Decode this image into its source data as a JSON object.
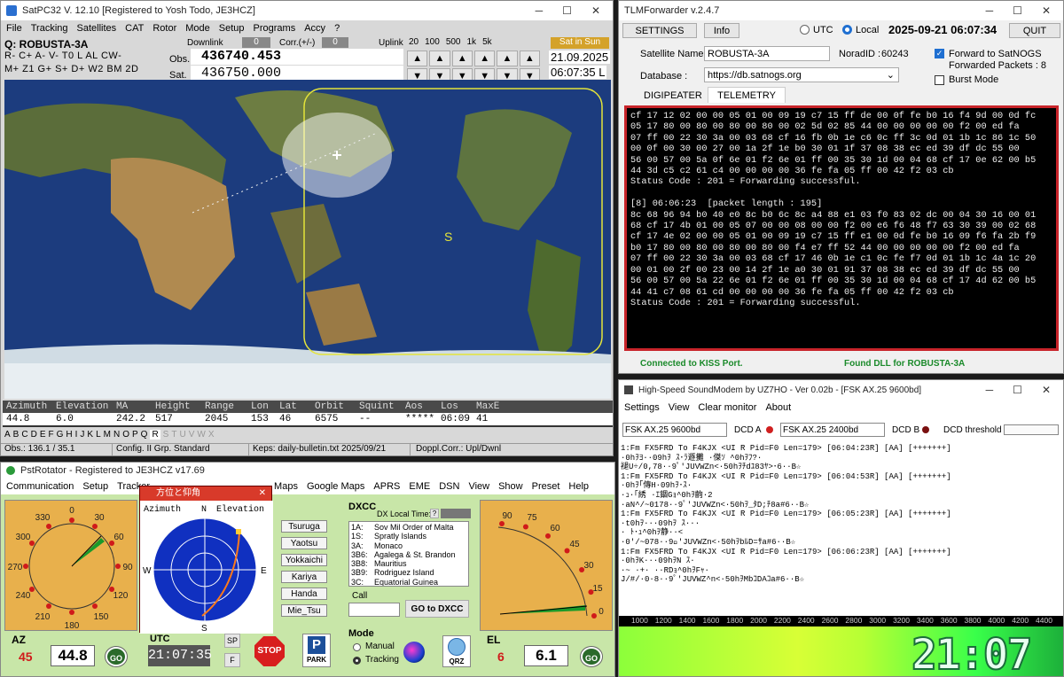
{
  "satpc": {
    "title": "SatPC32  V. 12.10    [Registered to Yosh Todo, JE3HCZ]",
    "menu": [
      "File",
      "Tracking",
      "Satellites",
      "CAT",
      "Rotor",
      "Mode",
      "Setup",
      "Programs",
      "Accy",
      "?"
    ],
    "sat_label": "Q: ROBUSTA-3A",
    "downlink_label": "Downlink",
    "downlink_val": "0",
    "corr_label": "Corr.(+/-)",
    "corr_val": "0",
    "uplink_label": "Uplink",
    "steps": [
      "20",
      "100",
      "500",
      "1k",
      "5k"
    ],
    "sat_in_sun": "Sat in Sun",
    "row1": "R- C+ A- V-  T0  L  AL  CW-",
    "row2": "M+ Z1 G+ S+ D+  W2 BM  2D",
    "obs_label": "Obs.",
    "obs_freq": "436740.453",
    "sat_label2": "Sat.",
    "sat_freq": "436750.000",
    "date": "21.09.2025",
    "time": "06:07:35 L",
    "map_marker": "S",
    "table_headers": [
      "Azimuth",
      "Elevation",
      "MA",
      "Height",
      "Range",
      "Lon",
      "Lat",
      "Orbit",
      "Squint",
      "Aos",
      "Los",
      "MaxE"
    ],
    "table_values": [
      "44.8",
      "6.0",
      "242.2",
      "517",
      "2045",
      "153",
      "46",
      "6575",
      "--",
      "*****",
      "06:09",
      "41"
    ],
    "alphabet": [
      "A",
      "B",
      "C",
      "D",
      "E",
      "F",
      "G",
      "H",
      "I",
      "J",
      "K",
      "L",
      "M",
      "N",
      "O",
      "P",
      "Q",
      "R",
      "S",
      "T",
      "U",
      "V",
      "W",
      "X"
    ],
    "status": [
      "Obs.: 136.1 / 35.1",
      "Config. II  Grp. Standard",
      "Keps: daily-bulletin.txt 2025/09/21",
      "Doppl.Corr.: Upl/Dwnl"
    ]
  },
  "tlm": {
    "title": "TLMForwarder v.2.4.7",
    "settings": "SETTINGS",
    "info": "Info",
    "utc": "UTC",
    "local": "Local",
    "datetime": "2025-09-21  06:07:34",
    "quit": "QUIT",
    "sat_name_label": "Satellite Name :",
    "sat_name": "ROBUSTA-3A",
    "norad_label": "NoradID :",
    "norad": "60243",
    "fwd_label": "Forward to SatNOGS",
    "fwd_packets": "Forwarded Packets :  8",
    "burst": "Burst Mode",
    "db_label": "Database :",
    "db": "https://db.satnogs.org",
    "tab1": "DIGIPEATER",
    "tab2": "TELEMETRY",
    "log": [
      "cf 17 12 02 00 00 05 01 00 09 19 c7 15 ff de 00 0f fe b0 16 f4 9d 00 0d fc",
      "05 17 80 00 80 00 80 00 80 00 02 5d 02 85 44 00 00 00 00 00 f2 00 ed fa",
      "07 ff 00 22 30 3a 00 03 68 cf 16 fb 0b 1e c6 0c ff 3c 0d 01 1b 1c 86 1c 50",
      "00 0f 00 30 00 27 00 1a 2f 1e b0 30 01 1f 37 08 38 ec ed 39 df dc 55 00",
      "56 00 57 00 5a 0f 6e 01 f2 6e 01 ff 00 35 30 1d 00 04 68 cf 17 0e 62 00 b5",
      "44 3d c5 c2 61 c4 00 00 00 00 36 fe fa 05 ff 00 42 f2 03 cb",
      "Status Code : 201 = Forwarding successful.",
      "",
      "[8] 06:06:23  [packet length : 195]",
      "8c 68 96 94 b0 40 e0 8c b0 6c 8c a4 88 e1 03 f0 83 02 dc 00 04 30 16 00 01",
      "68 cf 17 4b 01 00 05 07 00 00 08 00 00 f2 00 e6 f6 48 f7 63 30 39 00 02 68",
      "cf 17 4e 02 00 00 05 01 00 09 19 c7 15 ff e1 00 0d fe b0 16 09 f6 fa 2b f9",
      "b0 17 80 00 80 00 80 00 80 00 f4 e7 ff 52 44 00 00 00 00 00 f2 00 ed fa",
      "07 ff 00 22 30 3a 00 03 68 cf 17 46 0b 1e c1 0c fe f7 0d 01 1b 1c 4a 1c 20",
      "00 01 00 2f 00 23 00 14 2f 1e a0 30 01 91 37 08 38 ec ed 39 df dc 55 00",
      "56 00 57 00 5a 22 6e 01 f2 6e 01 ff 00 35 30 1d 00 04 68 cf 17 4d 62 00 b5",
      "44 41 c7 08 61 cd 00 00 00 00 36 fe fa 05 ff 00 42 f2 03 cb",
      "Status Code : 201 = Forwarding successful."
    ],
    "kiss": "Connected to KISS Port.",
    "dll": "Found DLL for ROBUSTA-3A"
  },
  "snd": {
    "title": "High-Speed SoundModem by UZ7HO - Ver 0.02b - [FSK AX.25 9600bd]",
    "menu": [
      "Settings",
      "View",
      "Clear monitor",
      "About"
    ],
    "modem_a": "FSK AX.25 9600bd",
    "dcd_a": "DCD A",
    "modem_b": "FSK AX.25 2400bd",
    "dcd_b": "DCD B",
    "dcd_thr": "DCD threshold",
    "log": [
      "1:Fm FX5FRD To F4KJX <UI R Pid=F0 Len=179> [06:04:23R] [AA] [+++++++]",
      "·0hｦﾖ··09hｦ   ｽ･ﾗ遯攤  ·傑ｿ ^0hｦﾌ?·",
      "褪U÷/0,78··9ﾟ'JUVWZn<·50hｦﾁdﾕ83ﾔ>･6··B☆",
      "1:Fm FX5FRD To F4KJX <UI R Pid=F0 Len=179> [06:04:53R] [AA] [+++++++]",
      "·0hｦ｢傳H·09hｦ･ｽ·",
      "·ｭ·「綉    ·ｴ錮Gｮ^0hｦ齣·2",
      "·aN^/~0178··9ﾟ'JUVWZn<·50hｦ_ﾀD;ﾁ8a#6··B☆",
      "1:Fm FX5FRD To F4KJX <UI R Pid=F0 Len=179> [06:05:23R] [AA] [+++++++]",
      "·t0hｦ···09hｦ     ｽ···",
      "·   ﾄ･ｭ^0hｦ静··<",
      "·0'/~078··9ﾟ'JUVWZn<·50hｦbﾙD=ｻa#6··B☆",
      "1:Fm FX5FRD To F4KJX <UI R Pid=F0 Len=179> [06:06:23R] [AA] [+++++++]",
      "·0hｦK···09hｦN    ｽ·",
      "·~        ·+·      ··RDｮ^0hｦFｬ·",
      "J/#/·0·8··9ﾟ'JUVWZ^n<·50hｦMbｺDAｺa#6··B☆"
    ],
    "freqs": [
      "1000",
      "1200",
      "1400",
      "1600",
      "1800",
      "2000",
      "2200",
      "2400",
      "2600",
      "2800",
      "3000",
      "3200",
      "3400",
      "3600",
      "3800",
      "4000",
      "4200",
      "4400"
    ],
    "clock": "21:07"
  },
  "pst": {
    "title": "PstRotator - Registered to JE3HCZ    v17.69",
    "menu": [
      "Communication",
      "Setup",
      "Tracker",
      "Maps",
      "Google Maps",
      "APRS",
      "EME",
      "DSN",
      "View",
      "Show",
      "Preset",
      "Help"
    ],
    "az_ticks": [
      "0",
      "30",
      "60",
      "90",
      "120",
      "150",
      "180",
      "210",
      "240",
      "270",
      "300",
      "330"
    ],
    "el_ticks": [
      "90",
      "75",
      "60",
      "45",
      "30",
      "15",
      "0"
    ],
    "az_label": "AZ",
    "az_set": "45",
    "az_val": "44.8",
    "go": "GO",
    "utc_label": "UTC",
    "utc": "21:07:35",
    "sp": "SP",
    "f": "F",
    "stop": "STOP",
    "park": "PARK",
    "el_label": "EL",
    "el_set": "6",
    "el_val": "6.1",
    "popup_title": "方位と仰角",
    "popup_az": "Azimuth",
    "popup_n": "N",
    "popup_el": "Elevation",
    "popup_w": "W",
    "popup_e": "E",
    "popup_s": "S",
    "cities": [
      "Tsuruga",
      "Yaotsu",
      "Yokkaichi",
      "Kariya",
      "Handa",
      "Mie_Tsu"
    ],
    "dxcc_label": "DXCC",
    "dx_local": "DX Local Time:",
    "dx_q": "?",
    "dxcc": [
      [
        "1A:",
        "Sov Mil Order of Malta"
      ],
      [
        "1S:",
        "Spratly Islands"
      ],
      [
        "3A:",
        "Monaco"
      ],
      [
        "3B6:",
        "Agalega & St. Brandon"
      ],
      [
        "3B8:",
        "Mauritius"
      ],
      [
        "3B9:",
        "Rodriguez Island"
      ],
      [
        "3C:",
        "Equatorial Guinea"
      ]
    ],
    "call_label": "Call",
    "go_dxcc": "GO to DXCC",
    "mode_label": "Mode",
    "manual": "Manual",
    "tracking": "Tracking",
    "qrz": "QRZ"
  }
}
